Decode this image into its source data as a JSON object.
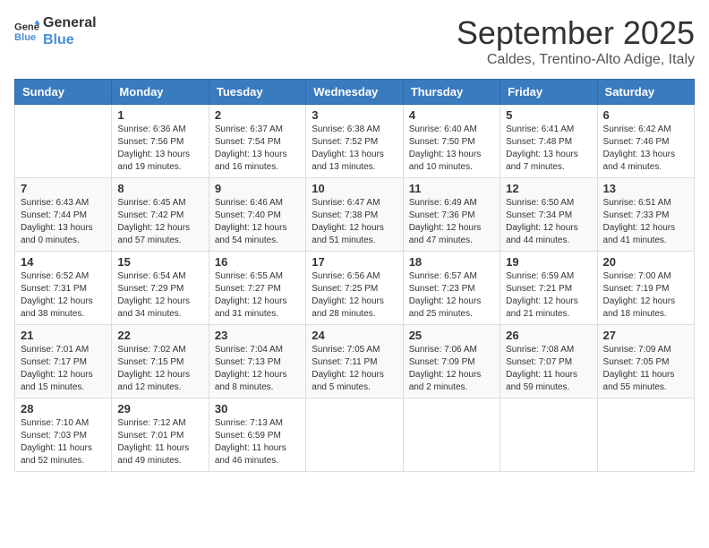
{
  "logo": {
    "general": "General",
    "blue": "Blue"
  },
  "header": {
    "month": "September 2025",
    "location": "Caldes, Trentino-Alto Adige, Italy"
  },
  "weekdays": [
    "Sunday",
    "Monday",
    "Tuesday",
    "Wednesday",
    "Thursday",
    "Friday",
    "Saturday"
  ],
  "weeks": [
    [
      {
        "day": "",
        "sunrise": "",
        "sunset": "",
        "daylight": ""
      },
      {
        "day": "1",
        "sunrise": "Sunrise: 6:36 AM",
        "sunset": "Sunset: 7:56 PM",
        "daylight": "Daylight: 13 hours and 19 minutes."
      },
      {
        "day": "2",
        "sunrise": "Sunrise: 6:37 AM",
        "sunset": "Sunset: 7:54 PM",
        "daylight": "Daylight: 13 hours and 16 minutes."
      },
      {
        "day": "3",
        "sunrise": "Sunrise: 6:38 AM",
        "sunset": "Sunset: 7:52 PM",
        "daylight": "Daylight: 13 hours and 13 minutes."
      },
      {
        "day": "4",
        "sunrise": "Sunrise: 6:40 AM",
        "sunset": "Sunset: 7:50 PM",
        "daylight": "Daylight: 13 hours and 10 minutes."
      },
      {
        "day": "5",
        "sunrise": "Sunrise: 6:41 AM",
        "sunset": "Sunset: 7:48 PM",
        "daylight": "Daylight: 13 hours and 7 minutes."
      },
      {
        "day": "6",
        "sunrise": "Sunrise: 6:42 AM",
        "sunset": "Sunset: 7:46 PM",
        "daylight": "Daylight: 13 hours and 4 minutes."
      }
    ],
    [
      {
        "day": "7",
        "sunrise": "Sunrise: 6:43 AM",
        "sunset": "Sunset: 7:44 PM",
        "daylight": "Daylight: 13 hours and 0 minutes."
      },
      {
        "day": "8",
        "sunrise": "Sunrise: 6:45 AM",
        "sunset": "Sunset: 7:42 PM",
        "daylight": "Daylight: 12 hours and 57 minutes."
      },
      {
        "day": "9",
        "sunrise": "Sunrise: 6:46 AM",
        "sunset": "Sunset: 7:40 PM",
        "daylight": "Daylight: 12 hours and 54 minutes."
      },
      {
        "day": "10",
        "sunrise": "Sunrise: 6:47 AM",
        "sunset": "Sunset: 7:38 PM",
        "daylight": "Daylight: 12 hours and 51 minutes."
      },
      {
        "day": "11",
        "sunrise": "Sunrise: 6:49 AM",
        "sunset": "Sunset: 7:36 PM",
        "daylight": "Daylight: 12 hours and 47 minutes."
      },
      {
        "day": "12",
        "sunrise": "Sunrise: 6:50 AM",
        "sunset": "Sunset: 7:34 PM",
        "daylight": "Daylight: 12 hours and 44 minutes."
      },
      {
        "day": "13",
        "sunrise": "Sunrise: 6:51 AM",
        "sunset": "Sunset: 7:33 PM",
        "daylight": "Daylight: 12 hours and 41 minutes."
      }
    ],
    [
      {
        "day": "14",
        "sunrise": "Sunrise: 6:52 AM",
        "sunset": "Sunset: 7:31 PM",
        "daylight": "Daylight: 12 hours and 38 minutes."
      },
      {
        "day": "15",
        "sunrise": "Sunrise: 6:54 AM",
        "sunset": "Sunset: 7:29 PM",
        "daylight": "Daylight: 12 hours and 34 minutes."
      },
      {
        "day": "16",
        "sunrise": "Sunrise: 6:55 AM",
        "sunset": "Sunset: 7:27 PM",
        "daylight": "Daylight: 12 hours and 31 minutes."
      },
      {
        "day": "17",
        "sunrise": "Sunrise: 6:56 AM",
        "sunset": "Sunset: 7:25 PM",
        "daylight": "Daylight: 12 hours and 28 minutes."
      },
      {
        "day": "18",
        "sunrise": "Sunrise: 6:57 AM",
        "sunset": "Sunset: 7:23 PM",
        "daylight": "Daylight: 12 hours and 25 minutes."
      },
      {
        "day": "19",
        "sunrise": "Sunrise: 6:59 AM",
        "sunset": "Sunset: 7:21 PM",
        "daylight": "Daylight: 12 hours and 21 minutes."
      },
      {
        "day": "20",
        "sunrise": "Sunrise: 7:00 AM",
        "sunset": "Sunset: 7:19 PM",
        "daylight": "Daylight: 12 hours and 18 minutes."
      }
    ],
    [
      {
        "day": "21",
        "sunrise": "Sunrise: 7:01 AM",
        "sunset": "Sunset: 7:17 PM",
        "daylight": "Daylight: 12 hours and 15 minutes."
      },
      {
        "day": "22",
        "sunrise": "Sunrise: 7:02 AM",
        "sunset": "Sunset: 7:15 PM",
        "daylight": "Daylight: 12 hours and 12 minutes."
      },
      {
        "day": "23",
        "sunrise": "Sunrise: 7:04 AM",
        "sunset": "Sunset: 7:13 PM",
        "daylight": "Daylight: 12 hours and 8 minutes."
      },
      {
        "day": "24",
        "sunrise": "Sunrise: 7:05 AM",
        "sunset": "Sunset: 7:11 PM",
        "daylight": "Daylight: 12 hours and 5 minutes."
      },
      {
        "day": "25",
        "sunrise": "Sunrise: 7:06 AM",
        "sunset": "Sunset: 7:09 PM",
        "daylight": "Daylight: 12 hours and 2 minutes."
      },
      {
        "day": "26",
        "sunrise": "Sunrise: 7:08 AM",
        "sunset": "Sunset: 7:07 PM",
        "daylight": "Daylight: 11 hours and 59 minutes."
      },
      {
        "day": "27",
        "sunrise": "Sunrise: 7:09 AM",
        "sunset": "Sunset: 7:05 PM",
        "daylight": "Daylight: 11 hours and 55 minutes."
      }
    ],
    [
      {
        "day": "28",
        "sunrise": "Sunrise: 7:10 AM",
        "sunset": "Sunset: 7:03 PM",
        "daylight": "Daylight: 11 hours and 52 minutes."
      },
      {
        "day": "29",
        "sunrise": "Sunrise: 7:12 AM",
        "sunset": "Sunset: 7:01 PM",
        "daylight": "Daylight: 11 hours and 49 minutes."
      },
      {
        "day": "30",
        "sunrise": "Sunrise: 7:13 AM",
        "sunset": "Sunset: 6:59 PM",
        "daylight": "Daylight: 11 hours and 46 minutes."
      },
      {
        "day": "",
        "sunrise": "",
        "sunset": "",
        "daylight": ""
      },
      {
        "day": "",
        "sunrise": "",
        "sunset": "",
        "daylight": ""
      },
      {
        "day": "",
        "sunrise": "",
        "sunset": "",
        "daylight": ""
      },
      {
        "day": "",
        "sunrise": "",
        "sunset": "",
        "daylight": ""
      }
    ]
  ]
}
